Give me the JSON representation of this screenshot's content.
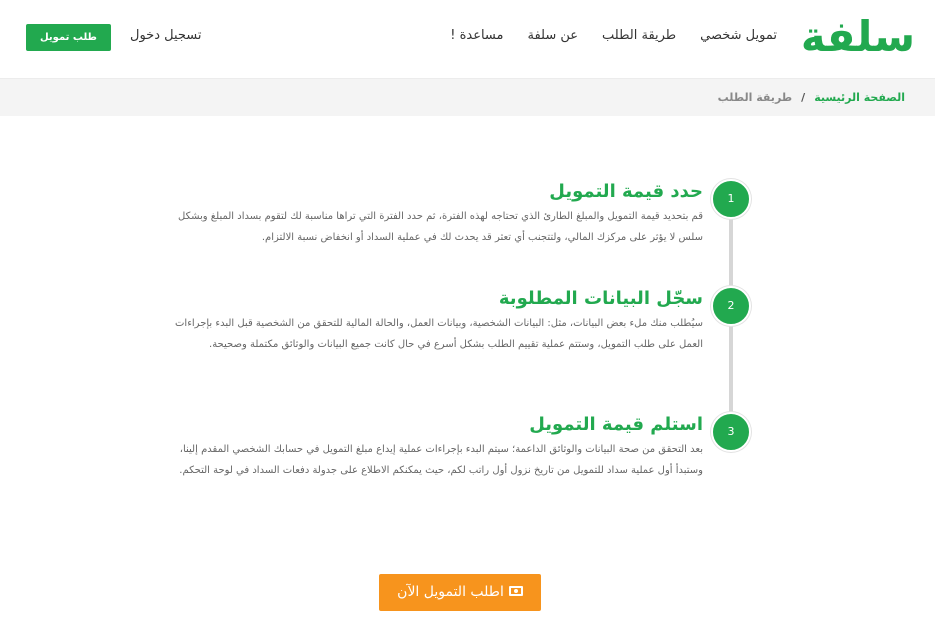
{
  "header": {
    "logo_text": "سلفة",
    "nav": [
      {
        "label": "تمويل شخصي"
      },
      {
        "label": "طريقة الطلب"
      },
      {
        "label": "عن سلفة"
      },
      {
        "label": "مساعدة !"
      }
    ],
    "login_label": "تسجيل دخول",
    "loan_button_label": "طلب تمويل"
  },
  "breadcrumb": {
    "home": "الصفحة الرئيسية",
    "separator": "/",
    "current": "طريقة الطلب"
  },
  "steps": [
    {
      "number": "1",
      "title": "حدد قيمة التمويل",
      "description": "قم بتحديد قيمة التمويل والمبلغ الطارئ الذي تحتاجه لهذه الفترة، ثم حدد الفترة التي تراها مناسبة لك لتقوم بسداد المبلغ وبشكل سلس لا يؤثر على مركزك المالي، ولتتجنب أي تعثر قد يحدث لك في عملية السداد أو انخفاض نسبة الالتزام."
    },
    {
      "number": "2",
      "title": "سجّل البيانات المطلوبة",
      "description": "سيُطلب منك ملء بعض البيانات، مثل: البيانات الشخصية، وبيانات العمل، والحالة المالية للتحقق من الشخصية قبل البدء بإجراءات العمل على طلب التمويل، وستتم عملية تقييم الطلب بشكل أسرع في حال كانت جميع البيانات والوثائق مكتملة وصحيحة."
    },
    {
      "number": "3",
      "title": "استلم قيمة التمويل",
      "description": "بعد التحقق من صحة البيانات والوثائق الداعمة؛ سيتم البدء بإجراءات عملية إيداع مبلغ التمويل في حسابك الشخصي المقدم إلينا، وستبدأ أول عملية سداد للتمويل من تاريخ نزول أول راتب لكم، حيث يمكنكم الاطلاع على جدولة دفعات السداد في لوحة التحكم."
    }
  ],
  "cta": {
    "label": "اطلب التمويل الآن",
    "icon": "money-icon"
  },
  "colors": {
    "brand_green": "#22a94f",
    "cta_orange": "#f7941d"
  }
}
